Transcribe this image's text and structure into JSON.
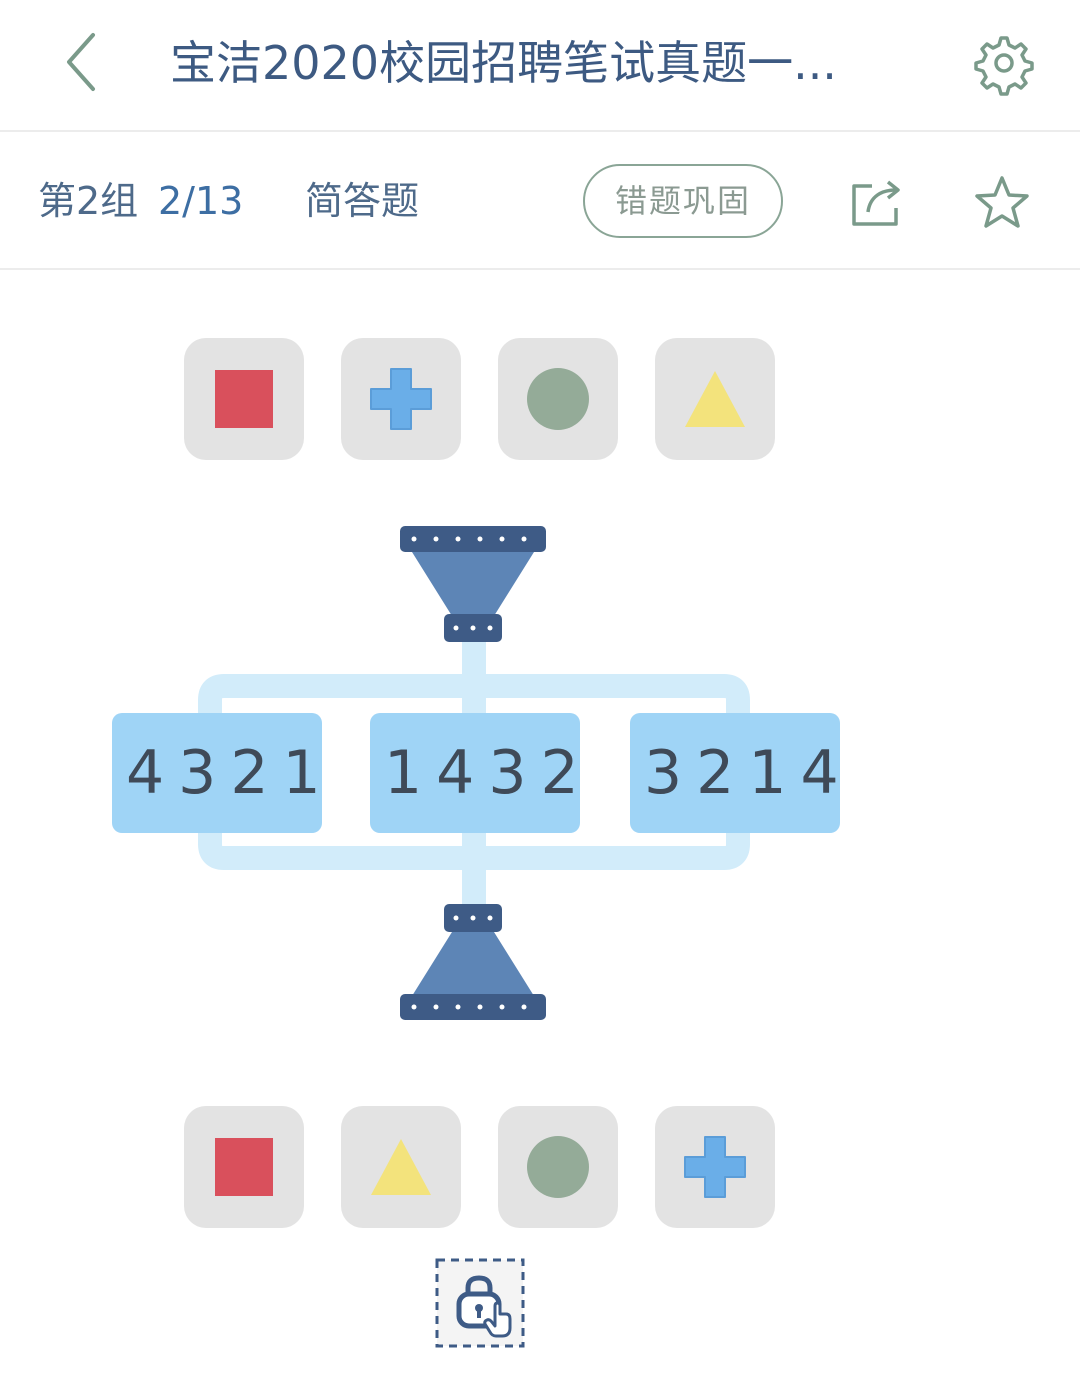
{
  "header": {
    "title": "宝洁2020校园招聘笔试真题一..."
  },
  "subheader": {
    "group_label": "第2组",
    "progress": "2/13",
    "question_type": "简答题",
    "review_button": "错题巩固"
  },
  "question": {
    "top_shapes": [
      "red-square",
      "blue-cross",
      "green-circle",
      "yellow-triangle"
    ],
    "codes": [
      "4321",
      "1432",
      "3214"
    ],
    "bottom_shapes": [
      "red-square",
      "yellow-triangle",
      "green-circle",
      "blue-cross"
    ]
  },
  "colors": {
    "red": "#d9505c",
    "blue": "#6aaee8",
    "green": "#94ab98",
    "yellow": "#f3e37c",
    "funnel": "#5d85b6",
    "funnel_dark": "#3e5b86",
    "pipe": "#d2ecfa",
    "code_box": "#9fd4f6",
    "title": "#3d5a82"
  }
}
